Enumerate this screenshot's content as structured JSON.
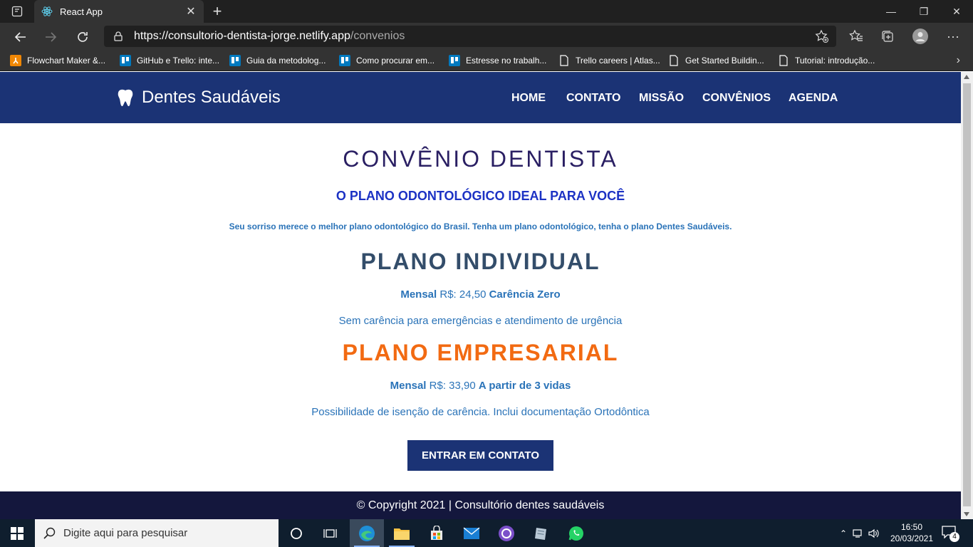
{
  "browser": {
    "tab_title": "React App",
    "url_host": "https://consultorio-dentista-jorge.netlify.app",
    "url_path": "/convenios",
    "bookmarks": [
      {
        "label": "Flowchart Maker &...",
        "icon": "drawio-icon",
        "color": "#f08705"
      },
      {
        "label": "GitHub e Trello: inte...",
        "icon": "trello-icon",
        "color": "#0079bf"
      },
      {
        "label": "Guia da metodolog...",
        "icon": "trello-icon",
        "color": "#0079bf"
      },
      {
        "label": "Como procurar em...",
        "icon": "trello-icon",
        "color": "#0079bf"
      },
      {
        "label": "Estresse no trabalh...",
        "icon": "trello-icon",
        "color": "#0079bf"
      },
      {
        "label": "Trello careers | Atlas...",
        "icon": "page-icon",
        "color": "#ffffff"
      },
      {
        "label": "Get Started Buildin...",
        "icon": "page-icon",
        "color": "#ffffff"
      },
      {
        "label": "Tutorial: introdução...",
        "icon": "page-icon",
        "color": "#ffffff"
      }
    ]
  },
  "site": {
    "brand": "Dentes Saudáveis",
    "nav": [
      "HOME",
      "CONTATO",
      "MISSÃO",
      "CONVÊNIOS",
      "AGENDA"
    ],
    "heading": "CONVÊNIO DENTISTA",
    "subheading": "O PLANO ODONTOLÓGICO IDEAL PARA VOCÊ",
    "description": "Seu sorriso merece o melhor plano odontológico do Brasil. Tenha um plano odontológico, tenha o plano Dentes Saudáveis.",
    "plans": [
      {
        "title": "PLANO INDIVIDUAL",
        "period_label": "Mensal",
        "price": "R$: 24,50",
        "highlight": "Carência Zero",
        "details": "Sem carência para emergências e atendimento de urgência"
      },
      {
        "title": "PLANO EMPRESARIAL",
        "period_label": "Mensal",
        "price": "R$: 33,90",
        "highlight": "A partir de 3 vidas",
        "details": "Possibilidade de isenção de carência. Inclui documentação Ortodôntica"
      }
    ],
    "cta": "ENTRAR EM CONTATO",
    "footer": "© Copyright 2021 | Consultório dentes saudáveis"
  },
  "taskbar": {
    "search_placeholder": "Digite aqui para pesquisar",
    "time": "16:50",
    "date": "20/03/2021",
    "notification_count": "4"
  },
  "colors": {
    "header_bg": "#1b3375",
    "footer_bg": "#14173d",
    "individual_title": "#334d6a",
    "empresarial_title": "#f26a12"
  }
}
